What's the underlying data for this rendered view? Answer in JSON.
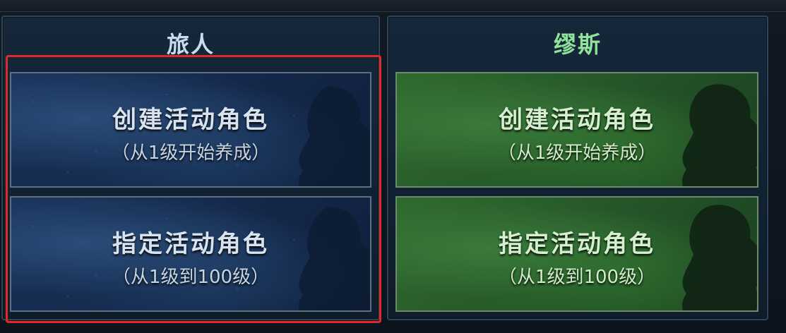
{
  "panels": {
    "left": {
      "title": "旅人",
      "buttons": [
        {
          "main": "创建活动角色",
          "sub": "（从1级开始养成）"
        },
        {
          "main": "指定活动角色",
          "sub": "（从1级到100级）"
        }
      ]
    },
    "right": {
      "title": "缪斯",
      "buttons": [
        {
          "main": "创建活动角色",
          "sub": "（从1级开始养成）"
        },
        {
          "main": "指定活动角色",
          "sub": "（从1级到100级）"
        }
      ]
    }
  },
  "colors": {
    "highlight": "#e02a2a",
    "left_theme": "#19335a",
    "right_theme": "#2f6b2d",
    "left_title": "#c8dcef",
    "right_title": "#8fe39b"
  },
  "icons": {
    "silhouette": "character-silhouette-icon"
  }
}
